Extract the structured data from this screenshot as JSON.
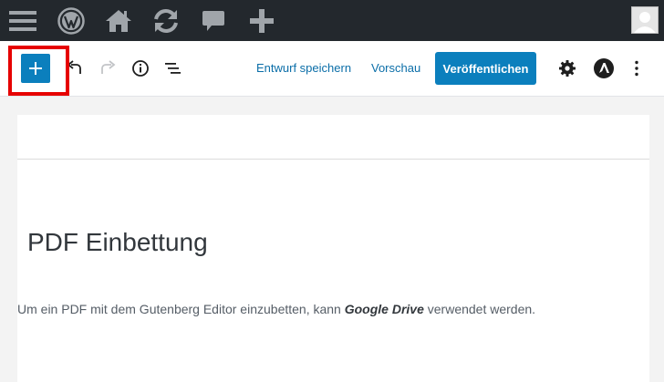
{
  "colors": {
    "admin_bar": "#23282d",
    "admin_icon": "#a0a5aa",
    "primary_blue": "#0b7fbd",
    "link_blue": "#0b6ea8",
    "highlight_red": "#e60000"
  },
  "admin_bar": {
    "icons": [
      "menu-icon",
      "wordpress-logo-icon",
      "home-icon",
      "updates-icon",
      "comments-icon",
      "new-content-icon",
      "avatar-icon"
    ]
  },
  "toolbar": {
    "add_block_icon": "plus-icon",
    "undo_icon": "undo-icon",
    "redo_icon": "redo-icon",
    "info_icon": "info-icon",
    "outline_icon": "block-navigation-icon",
    "save_draft_label": "Entwurf speichern",
    "preview_label": "Vorschau",
    "publish_label": "Veröffentlichen",
    "settings_icon": "gear-icon",
    "astra_icon": "astra-logo-icon",
    "more_icon": "more-vertical-icon"
  },
  "content": {
    "heading": "PDF Einbettung",
    "paragraph_before": "Um ein PDF mit dem Gutenberg Editor einzubetten, kann ",
    "paragraph_bold": "Google Drive",
    "paragraph_after": " verwendet werden."
  }
}
